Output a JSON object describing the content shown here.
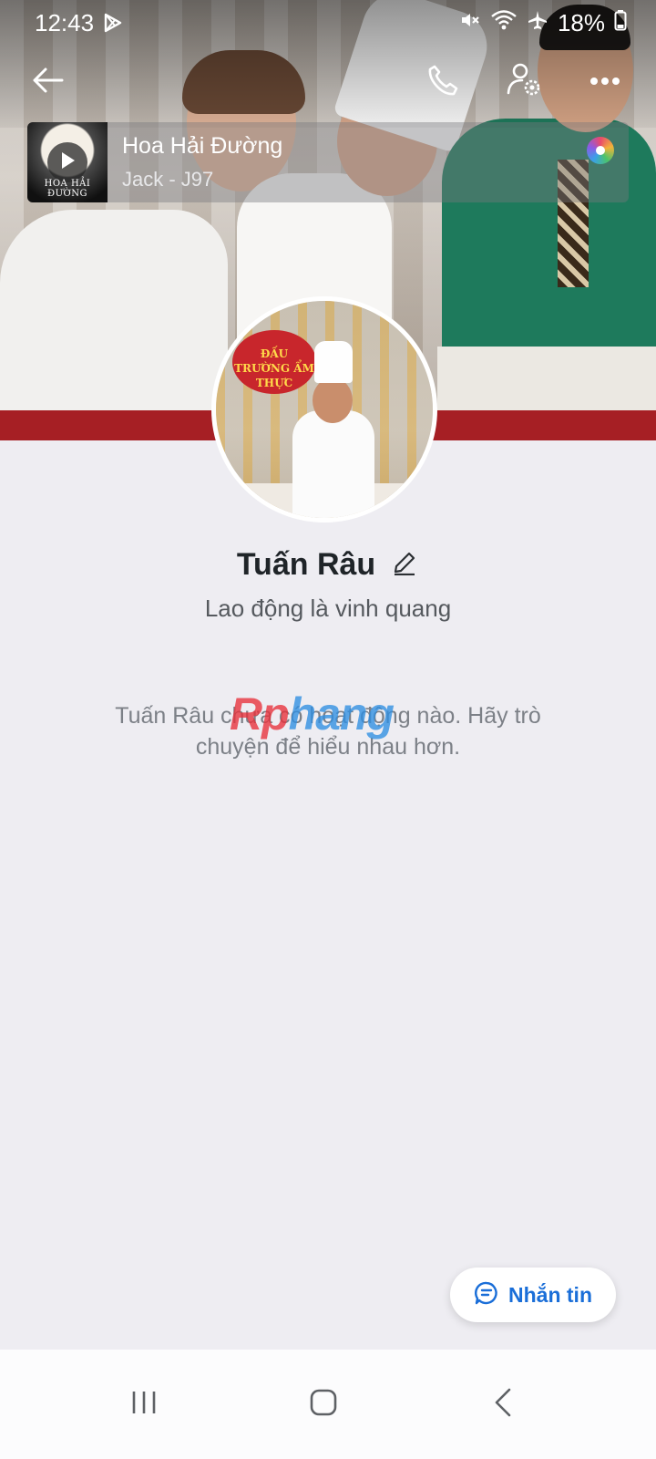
{
  "status_bar": {
    "time": "12:43",
    "battery": "18%"
  },
  "music": {
    "song": "Hoa Hải Đường",
    "artist": "Jack - J97",
    "thumb_caption": "HOA HẢI ĐƯỜNG"
  },
  "cover": {
    "sign_text": "ĐẤU TRƯỜNG ẨM THỰC"
  },
  "profile": {
    "name": "Tuấn Râu",
    "bio": "Lao động là vinh quang",
    "empty_message": "Tuấn Râu chưa có hoạt động nào. Hãy trò chuyện để hiểu nhau hơn."
  },
  "watermark": {
    "part1": "Rp",
    "part2": "hang"
  },
  "actions": {
    "message_label": "Nhắn tin"
  },
  "colors": {
    "accent": "#1a6ed8",
    "background": "#eeedf2"
  },
  "icons": [
    "back-arrow-icon",
    "phone-icon",
    "user-settings-icon",
    "more-icon",
    "play-icon",
    "music-disc-icon",
    "edit-pencil-icon",
    "chat-bubble-icon"
  ]
}
